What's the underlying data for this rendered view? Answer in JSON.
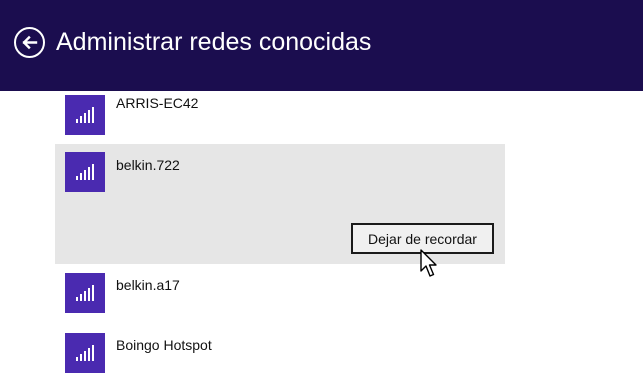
{
  "header": {
    "title": "Administrar redes conocidas",
    "back_icon": "back-arrow-circle-icon"
  },
  "networks": [
    {
      "name": "ARRIS-EC42",
      "icon": "wifi-signal-icon"
    },
    {
      "name": "belkin.722",
      "icon": "wifi-signal-icon",
      "selected": true
    },
    {
      "name": "belkin.a17",
      "icon": "wifi-signal-icon"
    },
    {
      "name": "Boingo Hotspot",
      "icon": "wifi-signal-icon"
    }
  ],
  "forget_button": {
    "label": "Dejar de recordar"
  },
  "colors": {
    "header_bg": "#1b0d4f",
    "tile_bg": "#4a2ab0",
    "selected_bg": "#e6e6e6"
  }
}
